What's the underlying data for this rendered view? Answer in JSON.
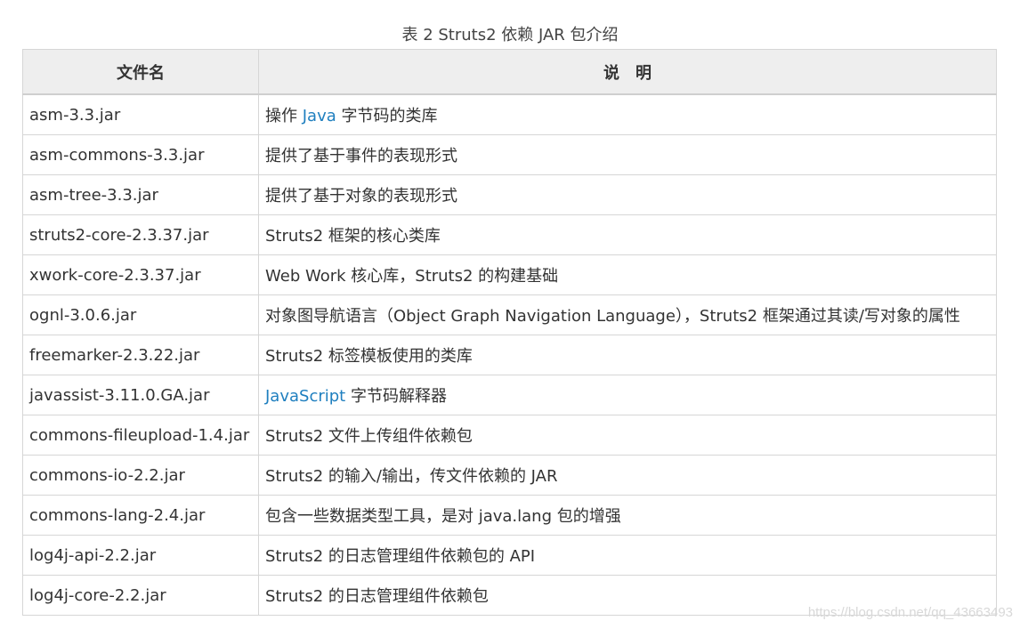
{
  "caption": "表 2 Struts2 依赖 JAR 包介绍",
  "table": {
    "headers": {
      "name": "文件名",
      "desc": "说　明"
    },
    "rows": [
      {
        "name": "asm-3.3.jar",
        "desc_pre": "操作 ",
        "desc_link": "Java",
        "desc_post": " 字节码的类库"
      },
      {
        "name": "asm-commons-3.3.jar",
        "desc_pre": "提供了基于事件的表现形式",
        "desc_link": "",
        "desc_post": ""
      },
      {
        "name": "asm-tree-3.3.jar",
        "desc_pre": "提供了基于对象的表现形式",
        "desc_link": "",
        "desc_post": ""
      },
      {
        "name": "struts2-core-2.3.37.jar",
        "desc_pre": "Struts2 框架的核心类库",
        "desc_link": "",
        "desc_post": ""
      },
      {
        "name": "xwork-core-2.3.37.jar",
        "desc_pre": "Web Work 核心库，Struts2 的构建基础",
        "desc_link": "",
        "desc_post": ""
      },
      {
        "name": "ognl-3.0.6.jar",
        "desc_pre": "对象图导航语言（Object Graph Navigation Language），Struts2 框架通过其读/写对象的属性",
        "desc_link": "",
        "desc_post": ""
      },
      {
        "name": "freemarker-2.3.22.jar",
        "desc_pre": "Struts2 标签模板使用的类库",
        "desc_link": "",
        "desc_post": ""
      },
      {
        "name": "javassist-3.11.0.GA.jar",
        "desc_pre": "",
        "desc_link": "JavaScript",
        "desc_post": " 字节码解释器"
      },
      {
        "name": "commons-fileupload-1.4.jar",
        "desc_pre": "Struts2 文件上传组件依赖包",
        "desc_link": "",
        "desc_post": ""
      },
      {
        "name": "commons-io-2.2.jar",
        "desc_pre": "Struts2 的输入/输出，传文件依赖的 JAR",
        "desc_link": "",
        "desc_post": ""
      },
      {
        "name": "commons-lang-2.4.jar",
        "desc_pre": "包含一些数据类型工具，是对 java.lang 包的增强",
        "desc_link": "",
        "desc_post": ""
      },
      {
        "name": "log4j-api-2.2.jar",
        "desc_pre": "Struts2 的日志管理组件依赖包的 API",
        "desc_link": "",
        "desc_post": ""
      },
      {
        "name": "log4j-core-2.2.jar",
        "desc_pre": "Struts2 的日志管理组件依赖包",
        "desc_link": "",
        "desc_post": ""
      }
    ]
  },
  "watermark": "https://blog.csdn.net/qq_43663493",
  "colors": {
    "link": "#1f7fbf",
    "header_bg": "#eeeeee",
    "border": "#d6d6d6"
  }
}
